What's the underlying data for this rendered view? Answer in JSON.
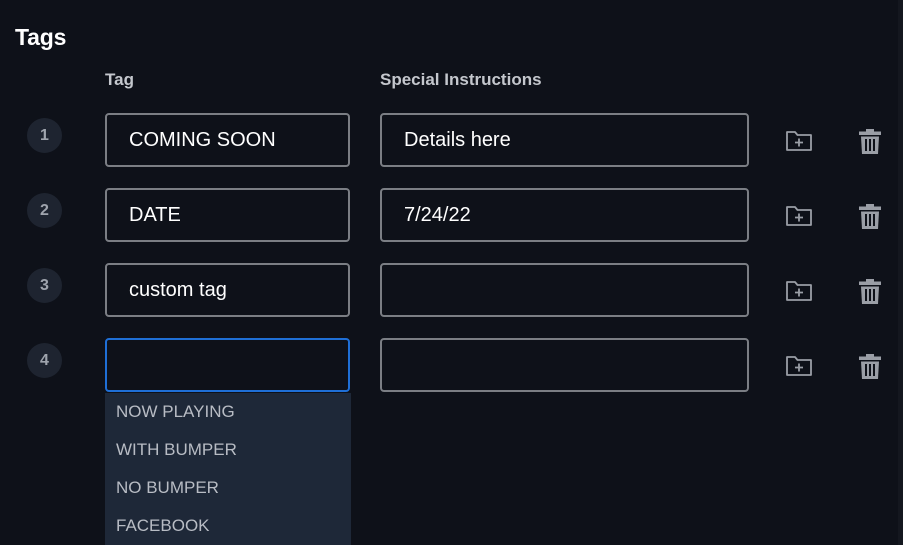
{
  "section": {
    "title": "Tags"
  },
  "columns": {
    "tag": "Tag",
    "instructions": "Special Instructions"
  },
  "rows": [
    {
      "number": "1",
      "tag": "COMING SOON",
      "instructions": "Details here"
    },
    {
      "number": "2",
      "tag": "DATE",
      "instructions": "7/24/22"
    },
    {
      "number": "3",
      "tag": "custom tag",
      "instructions": ""
    },
    {
      "number": "4",
      "tag": "",
      "instructions": ""
    }
  ],
  "dropdown": {
    "options": [
      "NOW PLAYING",
      "WITH BUMPER",
      "NO BUMPER",
      "FACEBOOK"
    ]
  },
  "icons": {
    "add_folder": "folder-plus-icon",
    "delete": "trash-icon"
  },
  "colors": {
    "background": "#0e1119",
    "field_border": "#7b7e84",
    "focus_border": "#1f6fd6",
    "dropdown_bg": "#1e2838",
    "icon": "#9a9ea6"
  }
}
